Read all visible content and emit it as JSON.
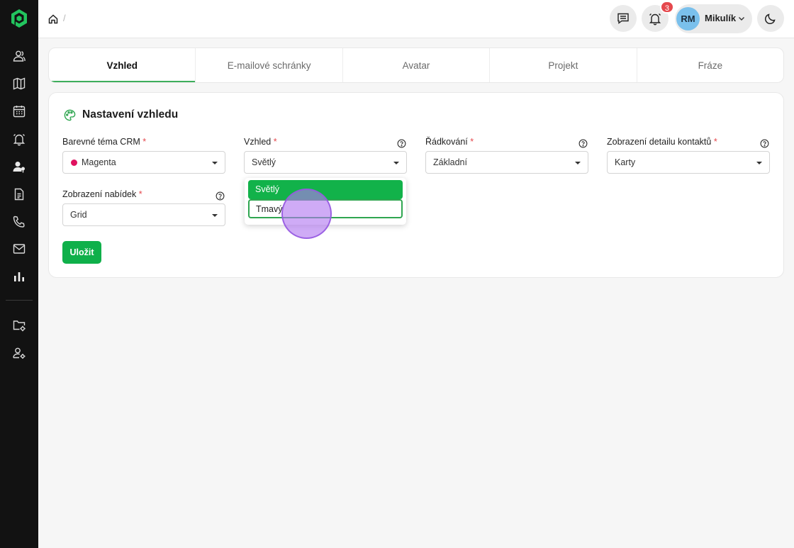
{
  "sidebar": {
    "items": [
      {
        "icon": "users-icon"
      },
      {
        "icon": "map-icon"
      },
      {
        "icon": "calendar-icon"
      },
      {
        "icon": "alarm-icon"
      },
      {
        "icon": "user-pin-icon"
      },
      {
        "icon": "document-icon"
      },
      {
        "icon": "phone-icon"
      },
      {
        "icon": "mail-icon"
      },
      {
        "icon": "bar-chart-icon"
      },
      {
        "icon": "folder-settings-icon"
      },
      {
        "icon": "user-settings-icon"
      }
    ]
  },
  "header": {
    "breadcrumb_sep": "/",
    "notifications_count": "3",
    "user": {
      "initials": "RM",
      "name": "Mikulík"
    }
  },
  "tabs": [
    {
      "label": "Vzhled",
      "active": true
    },
    {
      "label": "E-mailové schránky",
      "active": false
    },
    {
      "label": "Avatar",
      "active": false
    },
    {
      "label": "Projekt",
      "active": false
    },
    {
      "label": "Fráze",
      "active": false
    }
  ],
  "card": {
    "title": "Nastavení vzhledu",
    "fields": {
      "theme": {
        "label": "Barevné téma CRM",
        "value": "Magenta",
        "color": "#e0115f"
      },
      "appearance": {
        "label": "Vzhled",
        "value": "Světlý"
      },
      "spacing": {
        "label": "Řádkování",
        "value": "Základní"
      },
      "contact_detail": {
        "label": "Zobrazení detailu kontaktů",
        "value": "Karty"
      },
      "offers": {
        "label": "Zobrazení nabídek",
        "value": "Grid"
      }
    },
    "required_mark": "*",
    "dropdown_options": [
      "Světlý",
      "Tmavý"
    ],
    "save_label": "Uložit"
  },
  "colors": {
    "accent": "#12b24a",
    "sidebar_bg": "#121212",
    "badge": "#e5484d",
    "cursor": "#b278f0"
  }
}
